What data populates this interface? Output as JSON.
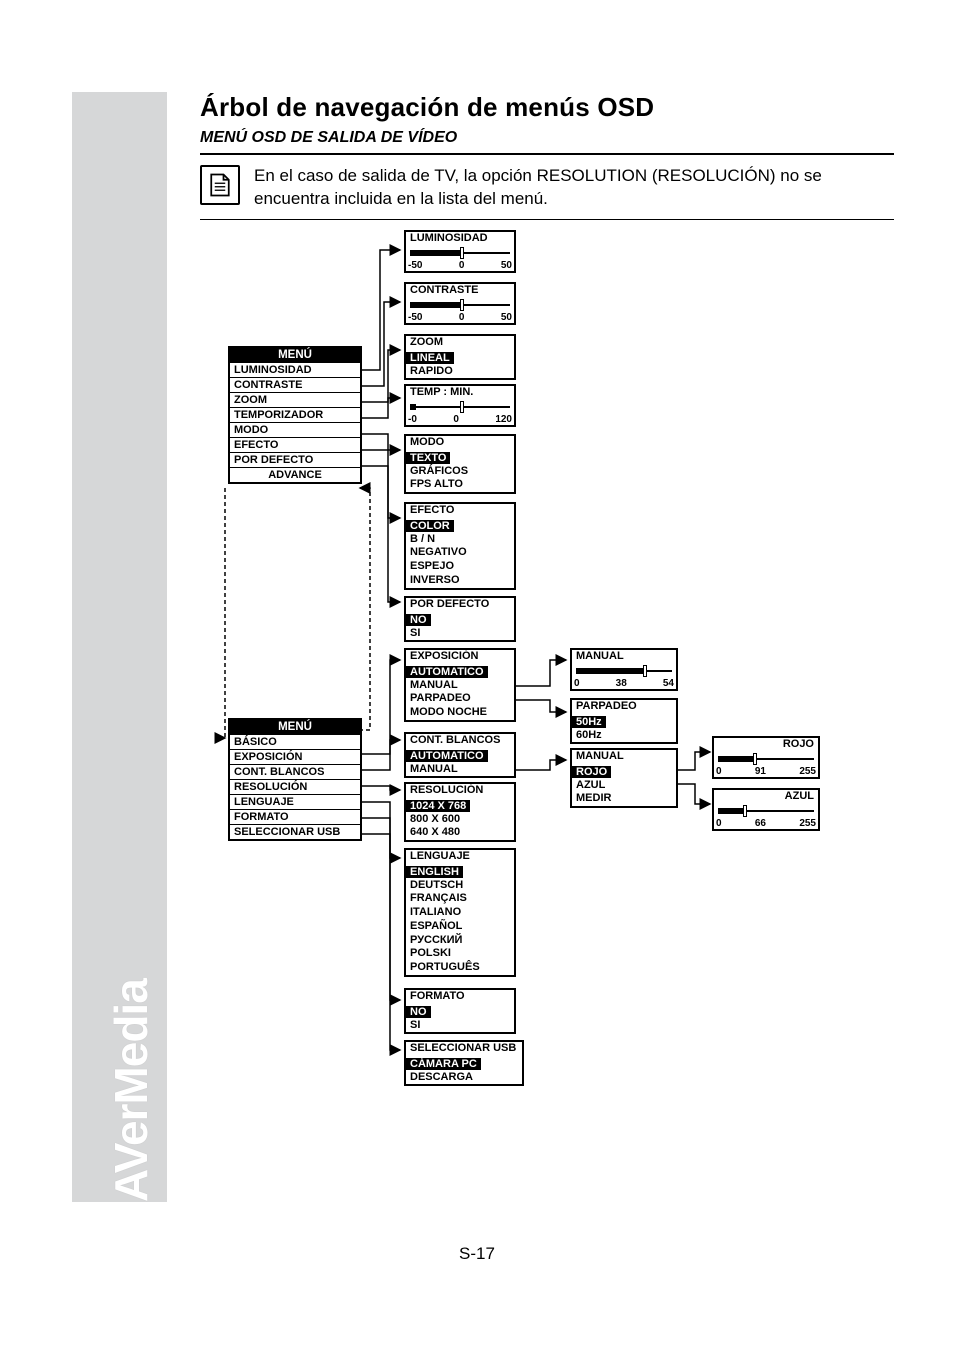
{
  "brand": "AVerMedia",
  "title": "Árbol de navegación de menús OSD",
  "subtitle": "MENÚ OSD DE SALIDA DE VÍDEO",
  "note": "En el caso de salida de TV, la opción RESOLUTION (RESOLUCIÓN) no se encuentra incluida en la lista del menú.",
  "page_number": "S-17",
  "menu1": {
    "header": "MENÚ",
    "items": [
      "LUMINOSIDAD",
      "CONTRASTE",
      "ZOOM",
      "TEMPORIZADOR",
      "MODO",
      "EFECTO",
      "POR DEFECTO",
      "ADVANCE"
    ]
  },
  "menu2": {
    "header": "MENÚ",
    "items": [
      "BÁSICO",
      "EXPOSICIÓN",
      "CONT. BLANCOS",
      "RESOLUCIÓN",
      "LENGUAJE",
      "FORMATO",
      "SELECCIONAR USB"
    ]
  },
  "lumin": {
    "header": "LUMINOSIDAD",
    "min": "-50",
    "mid": "0",
    "max": "50"
  },
  "contr": {
    "header": "CONTRASTE",
    "min": "-50",
    "mid": "0",
    "max": "50"
  },
  "zoom": {
    "header": "ZOOM",
    "sel": "LINEAL",
    "opt1": "RAPIDO"
  },
  "temp": {
    "header": "TEMP : MIN.",
    "min": "-0",
    "mid": "0",
    "max": "120"
  },
  "modo": {
    "header": "MODO",
    "sel": "TEXTO",
    "opt1": "GRÁFICOS",
    "opt2": "FPS ALTO"
  },
  "efecto": {
    "header": "EFECTO",
    "sel": "COLOR",
    "opts": [
      "B / N",
      "NEGATIVO",
      "ESPEJO",
      "INVERSO"
    ]
  },
  "defecto": {
    "header": "POR DEFECTO",
    "sel": "NO",
    "opt1": "SI"
  },
  "expo": {
    "header": "EXPOSICIÓN",
    "sel": "AUTOMATICO",
    "opts": [
      "MANUAL",
      "PARPADEO",
      "MODO NOCHE"
    ]
  },
  "expo_manual": {
    "header": "MANUAL",
    "min": "0",
    "mid": "38",
    "max": "54"
  },
  "parpadeo": {
    "header": "PARPADEO",
    "sel": "50Hz",
    "opt1": "60Hz"
  },
  "blancos": {
    "header": "CONT. BLANCOS",
    "sel": "AUTOMATICO",
    "opt1": "MANUAL"
  },
  "blancos_manual": {
    "header": "MANUAL",
    "sel": "ROJO",
    "opts": [
      "AZUL",
      "MEDIR"
    ]
  },
  "rojo": {
    "header": "ROJO",
    "min": "0",
    "mid": "91",
    "max": "255"
  },
  "azul": {
    "header": "AZUL",
    "min": "0",
    "mid": "66",
    "max": "255"
  },
  "resol": {
    "header": "RESOLUCIÓN",
    "sel": "1024 X 768",
    "opts": [
      "800 X 600",
      "640 X 480"
    ]
  },
  "leng": {
    "header": "LENGUAJE",
    "sel": "ENGLISH",
    "opts": [
      "DEUTSCH",
      "FRANÇAIS",
      "ITALIANO",
      "ESPAÑOL",
      "РУССКИЙ",
      "POLSKI",
      "PORTUGUÊS"
    ]
  },
  "formato": {
    "header": "FORMATO",
    "sel": "NO",
    "opt1": "SI"
  },
  "usb": {
    "header": "SELECCIONAR USB",
    "sel": "CÁMARA PC",
    "opt1": "DESCARGA"
  }
}
